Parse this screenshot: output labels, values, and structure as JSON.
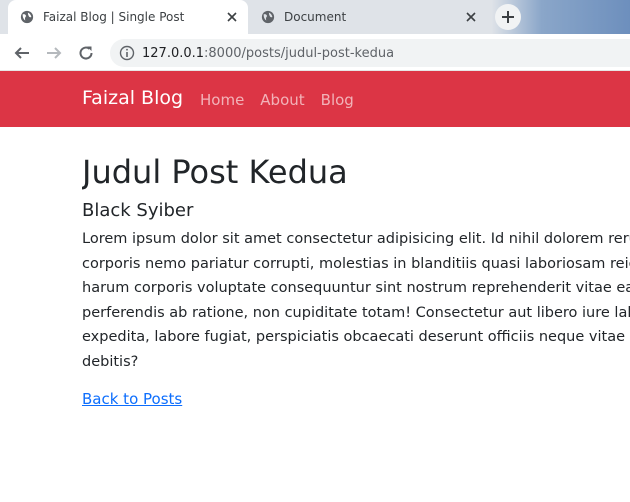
{
  "browser": {
    "tabs": [
      {
        "title": "Faizal Blog | Single Post",
        "icon": "globe-icon",
        "active": true
      },
      {
        "title": "Document",
        "icon": "globe-icon",
        "active": false
      }
    ],
    "url": {
      "host": "127.0.0.1",
      "rest": ":8000/posts/judul-post-kedua"
    }
  },
  "site": {
    "brand": "Faizal Blog",
    "nav": [
      "Home",
      "About",
      "Blog"
    ],
    "accent": "#dc3545"
  },
  "post": {
    "title": "Judul Post Kedua",
    "author": "Black Syiber",
    "lines": [
      "Lorem ipsum dolor sit amet consectetur adipisicing elit. Id nihil dolorem rerum",
      "corporis nemo pariatur corrupti, molestias in blanditiis quasi laboriosam reicie",
      "harum corporis voluptate consequuntur sint nostrum reprehenderit vitae earu",
      "perferendis ab ratione, non cupiditate totam! Consectetur aut libero iure labor",
      "expedita, labore fugiat, perspiciatis obcaecati deserunt officiis neque vitae nan",
      "debitis?"
    ],
    "back_link": "Back to Posts"
  }
}
